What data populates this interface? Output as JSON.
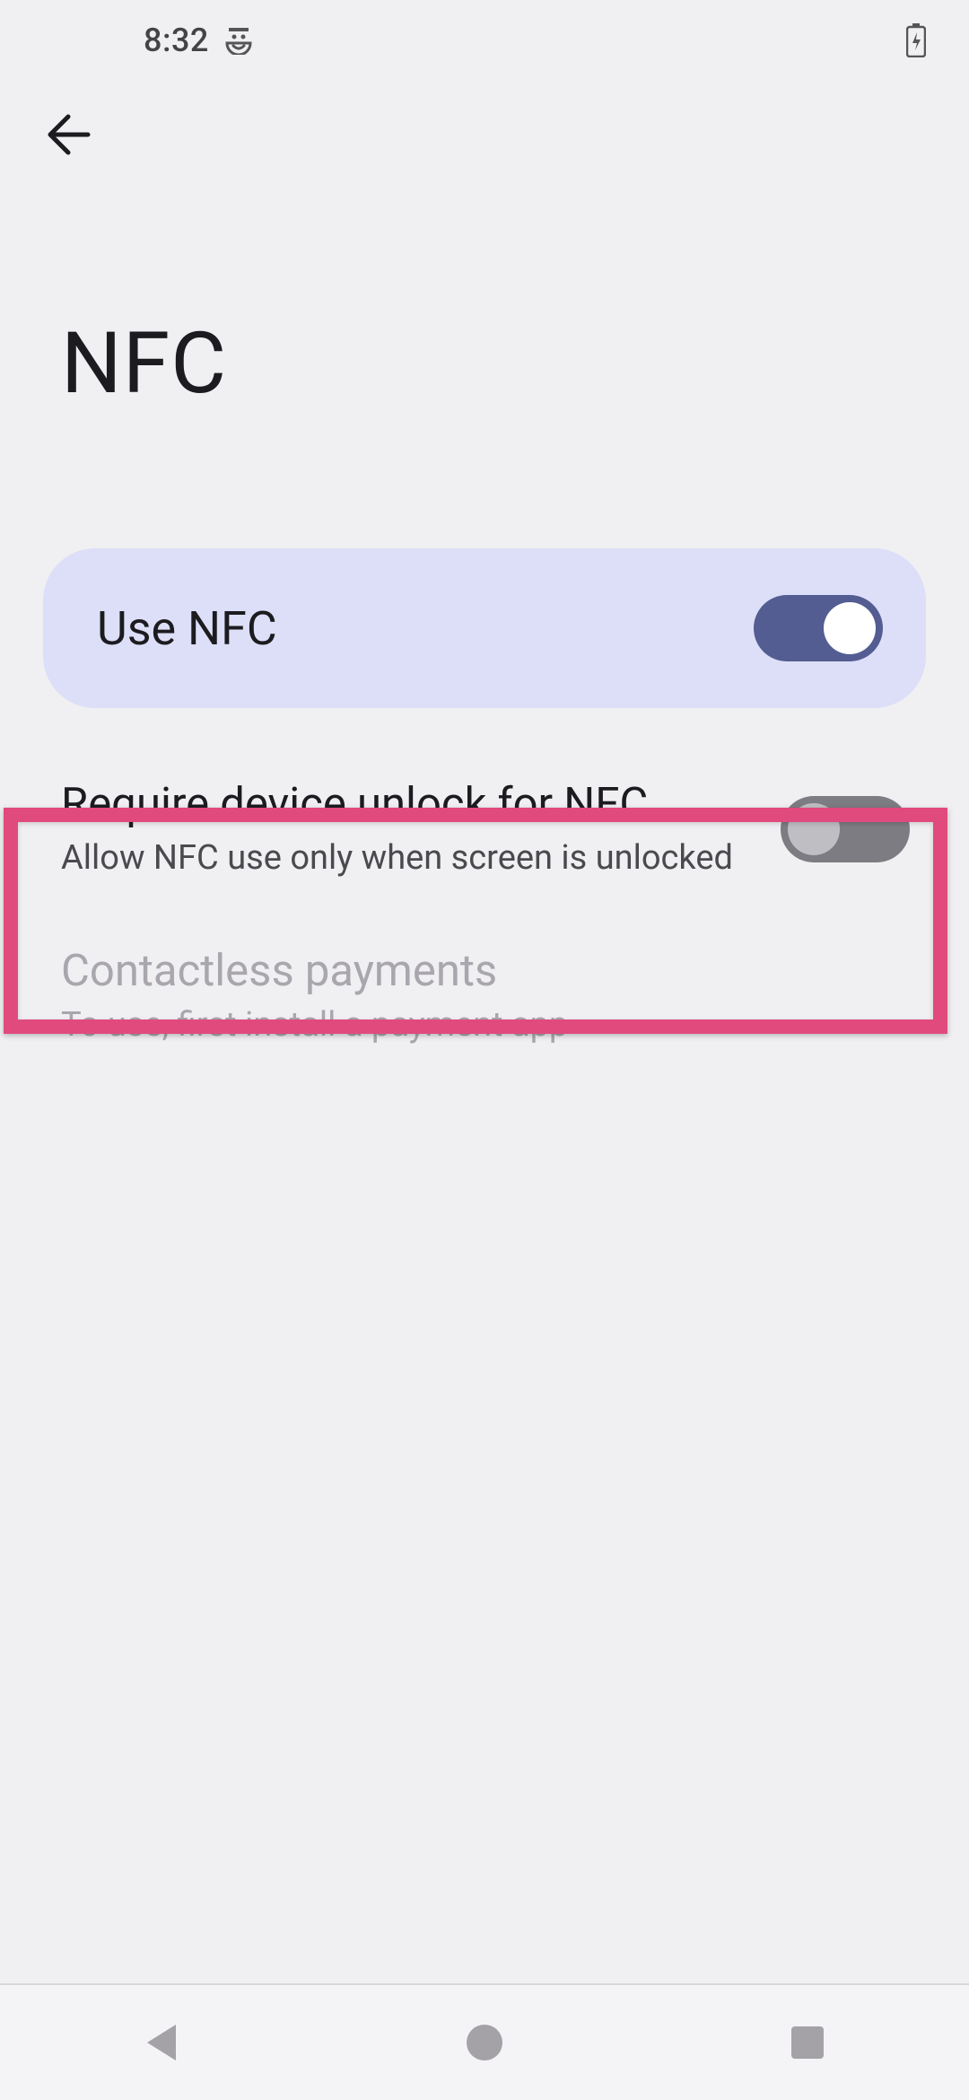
{
  "status": {
    "time": "8:32"
  },
  "page": {
    "title": "NFC"
  },
  "settings": {
    "use_nfc": {
      "label": "Use NFC",
      "state": "on"
    },
    "require_unlock": {
      "title": "Require device unlock for NFC",
      "subtitle": "Allow NFC use only when screen is unlocked",
      "state": "off"
    },
    "contactless": {
      "title": "Contactless payments",
      "subtitle": "To use, first install a payment app",
      "enabled": false
    }
  }
}
